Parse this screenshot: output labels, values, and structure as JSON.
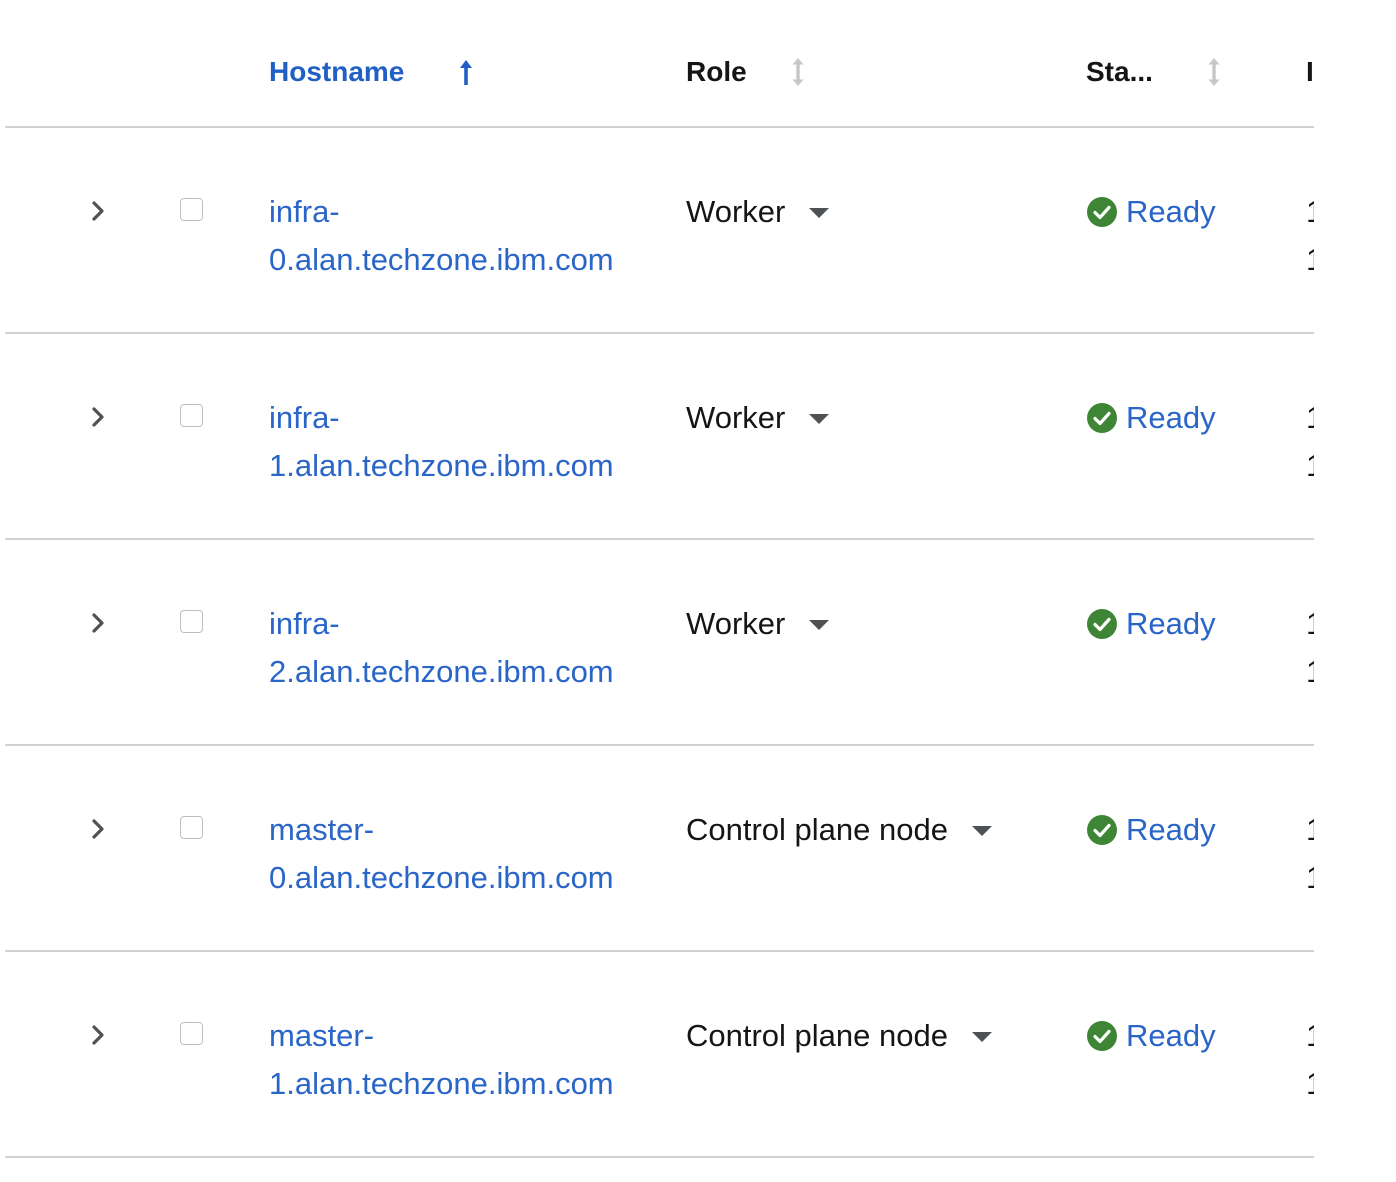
{
  "table": {
    "columns": {
      "hostname": "Hostname",
      "role": "Role",
      "status": "Sta...",
      "next": "I"
    },
    "sorted_column": "Hostname",
    "sort_direction": "ascending",
    "rows": [
      {
        "host_line1": "infra-",
        "host_line2": "0.alan.techzone.ibm.com",
        "role": "Worker",
        "status": "Ready",
        "cut1": "1",
        "cut2": "1"
      },
      {
        "host_line1": "infra-",
        "host_line2": "1.alan.techzone.ibm.com",
        "role": "Worker",
        "status": "Ready",
        "cut1": "1",
        "cut2": "1"
      },
      {
        "host_line1": "infra-",
        "host_line2": "2.alan.techzone.ibm.com",
        "role": "Worker",
        "status": "Ready",
        "cut1": "1",
        "cut2": "1"
      },
      {
        "host_line1": "master-",
        "host_line2": "0.alan.techzone.ibm.com",
        "role": "Control plane node",
        "status": "Ready",
        "cut1": "1",
        "cut2": "1"
      },
      {
        "host_line1": "master-",
        "host_line2": "1.alan.techzone.ibm.com",
        "role": "Control plane node",
        "status": "Ready",
        "cut1": "1",
        "cut2": "1"
      }
    ]
  },
  "colors": {
    "link": "#2a65c8",
    "sorted_header": "#2060c4",
    "ready_icon": "#3e8635",
    "divider": "#d2d2d2",
    "text": "#151515"
  },
  "icons": {
    "sort_active": "arrow-up-icon",
    "sort_inactive": "sort-updown-icon",
    "expand": "chevron-right-icon",
    "status": "check-circle-icon",
    "role_toggle": "caret-down-icon"
  }
}
